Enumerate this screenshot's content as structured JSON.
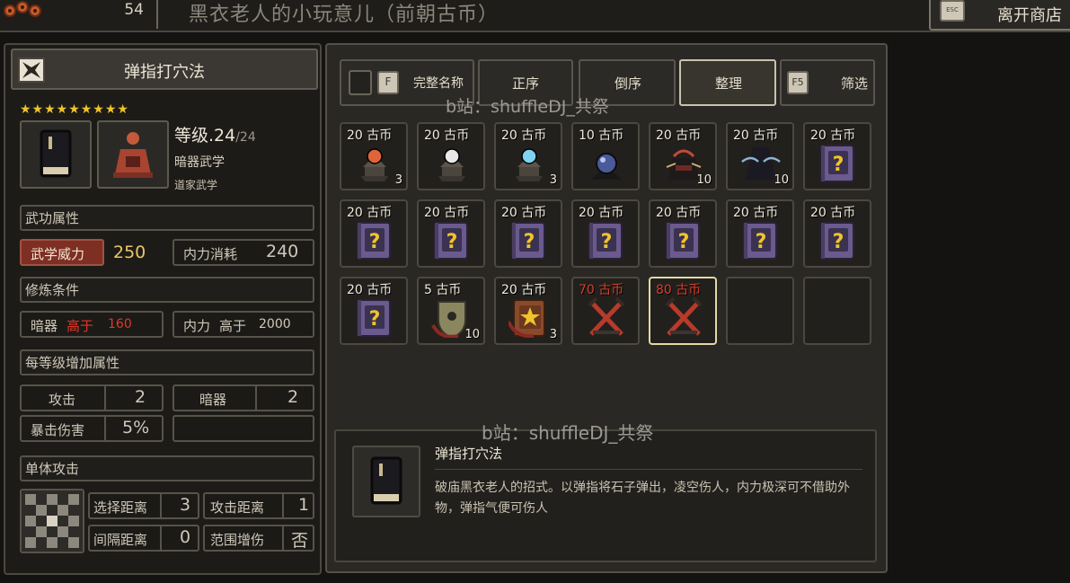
{
  "topbar": {
    "money": "54",
    "shop_title": "黑衣老人的小玩意儿（前朝古币）",
    "leave_key": "ESC",
    "leave_label": "离开商店"
  },
  "skill": {
    "title": "弹指打穴法",
    "stars": "★★★★★★★★★",
    "level_text": "等级.24",
    "level_max": "/24",
    "category": "暗器武学",
    "school": "道家武学"
  },
  "attributes": {
    "header": "武功属性",
    "power_label": "武学威力",
    "power_value": "250",
    "cost_label": "内力消耗",
    "cost_value": "240"
  },
  "requirements": {
    "header": "修炼条件",
    "req1_label": "暗器",
    "req1_cmp": "高于",
    "req1_value": "160",
    "req2_label": "内力",
    "req2_cmp": "高于",
    "req2_value": "2000"
  },
  "per_level": {
    "header": "每等级增加属性",
    "attack_label": "攻击",
    "attack_value": "2",
    "hidden_label": "暗器",
    "hidden_value": "2",
    "crit_label": "暴击伤害",
    "crit_value": "5%"
  },
  "target": {
    "header": "单体攻击",
    "select_range_label": "选择距离",
    "select_range_value": "3",
    "attack_range_label": "攻击距离",
    "attack_range_value": "1",
    "interval_label": "间隔距离",
    "interval_value": "0",
    "aoe_label": "范围增伤",
    "aoe_value": "否"
  },
  "tabs": {
    "full_name_key": "F",
    "full_name": "完整名称",
    "asc": "正序",
    "desc": "倒序",
    "sort": "整理",
    "filter_key": "F5",
    "filter": "筛选"
  },
  "items": [
    {
      "price": "20 古币",
      "qty": "3",
      "icon": "red-gem-pedestal-icon",
      "color": "#e0643a"
    },
    {
      "price": "20 古币",
      "qty": "",
      "icon": "white-pearl-pedestal-icon",
      "color": "#e8e8e8"
    },
    {
      "price": "20 古币",
      "qty": "3",
      "icon": "blue-gem-pedestal-icon",
      "color": "#7fd2f0"
    },
    {
      "price": "10 古币",
      "qty": "",
      "icon": "dark-orb-icon",
      "color": "#4a5a9a"
    },
    {
      "price": "20 古币",
      "qty": "10",
      "icon": "dark-pouch-icon",
      "color": "#c24a3a"
    },
    {
      "price": "20 古币",
      "qty": "10",
      "icon": "dark-cloak-icon",
      "color": "#8fb4d4"
    },
    {
      "price": "20 古币",
      "qty": "",
      "icon": "mystery-book-icon",
      "color": "#6a5a8e"
    },
    {
      "price": "20 古币",
      "qty": "",
      "icon": "mystery-book-icon",
      "color": "#6a5a8e"
    },
    {
      "price": "20 古币",
      "qty": "",
      "icon": "mystery-book-icon",
      "color": "#6a5a8e"
    },
    {
      "price": "20 古币",
      "qty": "",
      "icon": "mystery-book-icon",
      "color": "#6a5a8e"
    },
    {
      "price": "20 古币",
      "qty": "",
      "icon": "mystery-book-icon",
      "color": "#6a5a8e"
    },
    {
      "price": "20 古币",
      "qty": "",
      "icon": "mystery-book-icon",
      "color": "#6a5a8e"
    },
    {
      "price": "20 古币",
      "qty": "",
      "icon": "mystery-book-icon",
      "color": "#6a5a8e"
    },
    {
      "price": "20 古币",
      "qty": "",
      "icon": "mystery-book-icon",
      "color": "#6a5a8e"
    },
    {
      "price": "20 古币",
      "qty": "",
      "icon": "mystery-book-icon",
      "color": "#6a5a8e"
    },
    {
      "price": "5 古币",
      "qty": "10",
      "icon": "shield-emblem-icon",
      "color": "#8a8660"
    },
    {
      "price": "20 古币",
      "qty": "3",
      "icon": "star-book-icon",
      "color": "#8a4a2a"
    },
    {
      "price": "70 古币",
      "qty": "",
      "icon": "crossed-swords-icon",
      "color": "#b83a2a",
      "price_red": true
    },
    {
      "price": "80 古币",
      "qty": "",
      "icon": "crossed-swords-icon",
      "color": "#b83a2a",
      "price_red": true,
      "selected": true
    },
    {
      "price": "",
      "qty": "",
      "icon": "",
      "color": ""
    },
    {
      "price": "",
      "qty": "",
      "icon": "",
      "color": ""
    }
  ],
  "detail": {
    "name": "弹指打穴法",
    "description": "破庙黑衣老人的招式。以弹指将石子弹出，凌空伤人，内力极深可不借助外物，弹指气便可伤人"
  },
  "watermark": "b站：shuffleDJ_共祭"
}
